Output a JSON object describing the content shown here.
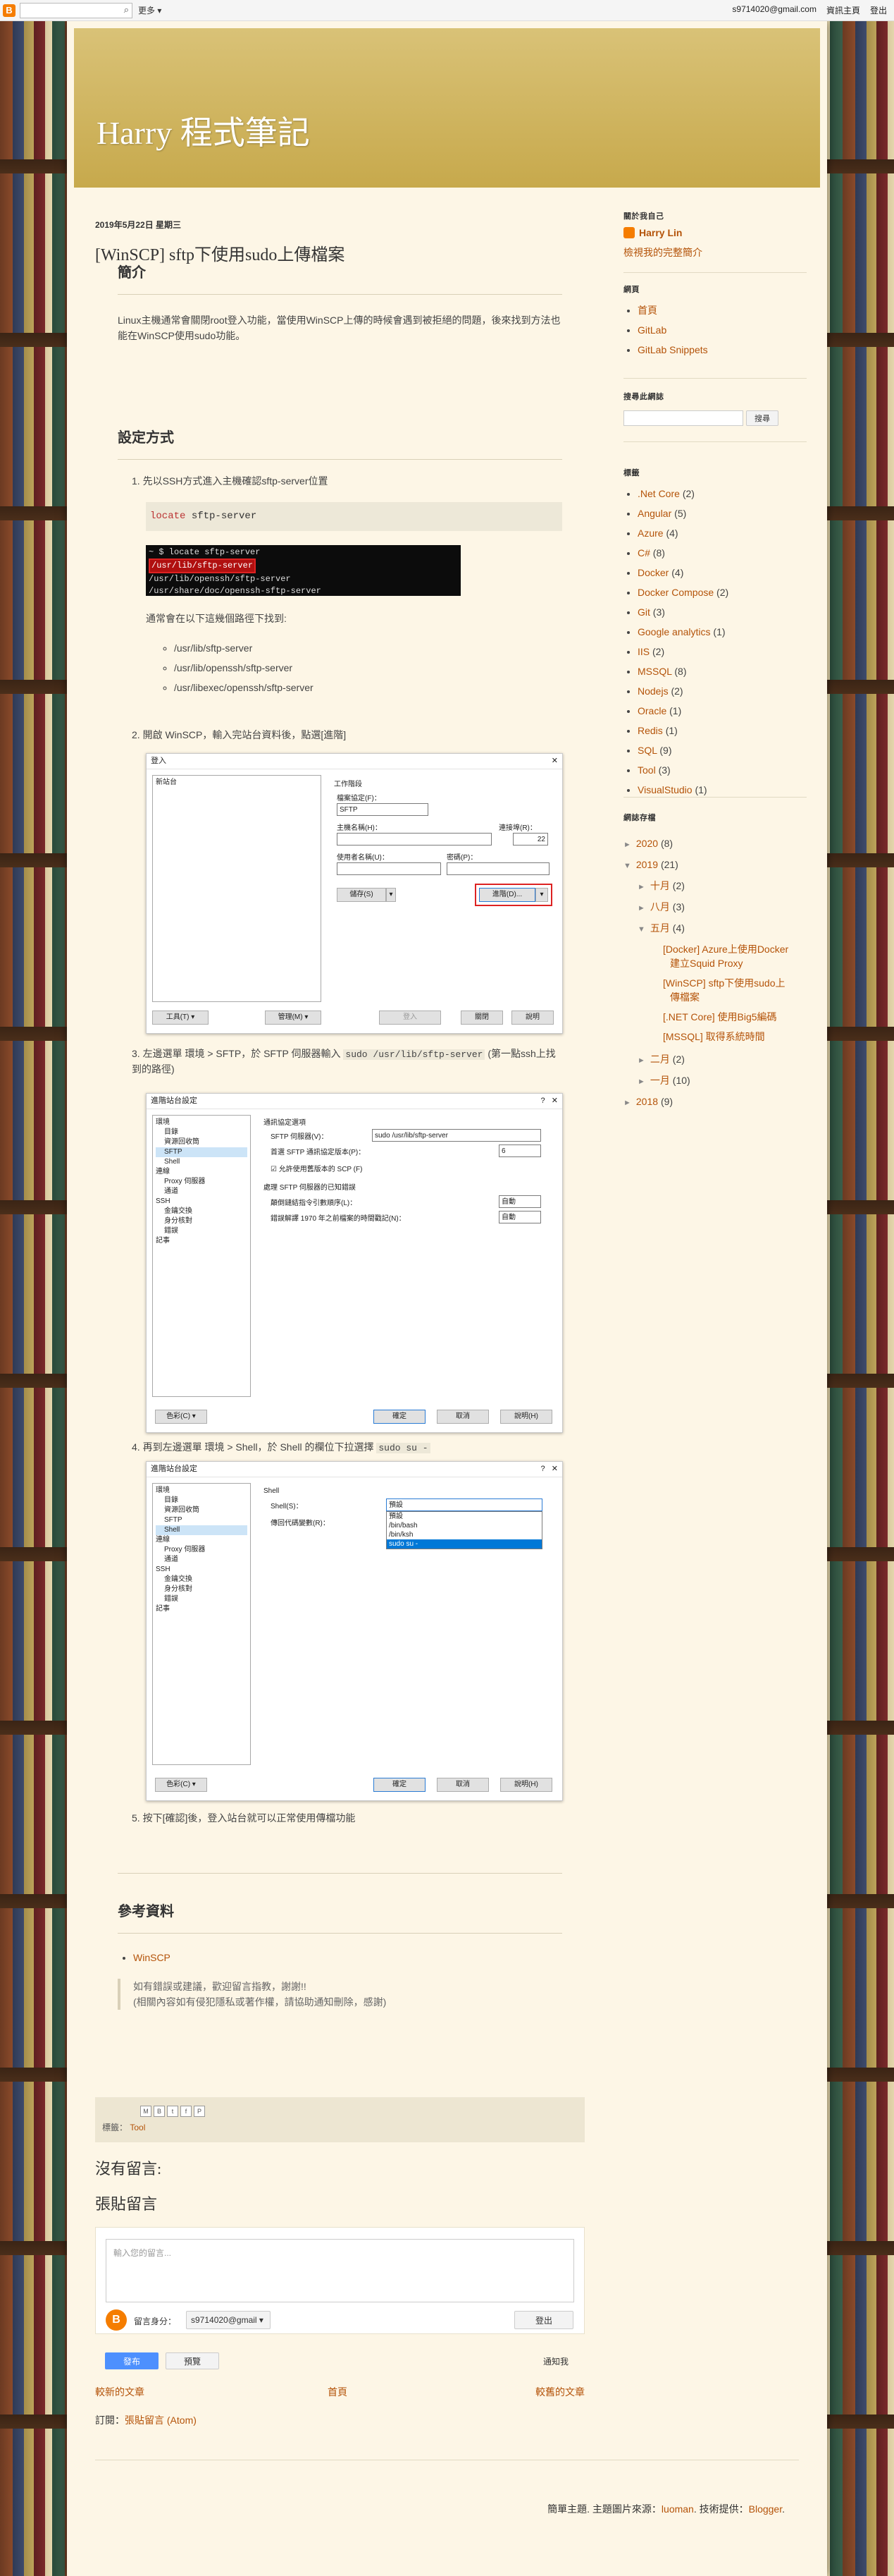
{
  "navbar": {
    "logo": "B",
    "more": "更多",
    "email": "s9714020@gmail.com",
    "dashboard": "資訊主頁",
    "logout": "登出"
  },
  "blog": {
    "title": "Harry 程式筆記"
  },
  "post": {
    "date": "2019年5月22日 星期三",
    "title": "[WinSCP] sftp下使用sudo上傳檔案",
    "intro_heading": "簡介",
    "intro_text": "Linux主機通常會關閉root登入功能，當使用WinSCP上傳的時候會遇到被拒絕的問題，後來找到方法也能在WinSCP使用sudo功能。",
    "setup_heading": "設定方式",
    "step1": "先以SSH方式進入主機確認sftp-server位置",
    "step1_code_kw": "locate",
    "step1_code_arg": " sftp-server",
    "terminal_lines": [
      "~ $ locate sftp-server",
      "/usr/lib/sftp-server",
      "/usr/lib/openssh/sftp-server",
      "/usr/share/doc/openssh-sftp-server"
    ],
    "paths_intro": "通常會在以下這幾個路徑下找到:",
    "paths": [
      "/usr/lib/sftp-server",
      "/usr/lib/openssh/sftp-server",
      "/usr/libexec/openssh/sftp-server"
    ],
    "step2": "開啟 WinSCP，輸入完站台資料後，點選[進階]",
    "step3_a": "左邊選單 環境 > SFTP，於 SFTP 伺服器輸入 ",
    "step3_code": "sudo /usr/lib/sftp-server",
    "step3_b": " (第一點ssh上找到的路徑)",
    "step4_a": "再到左邊選單 環境 > Shell，於 Shell 的欄位下拉選擇 ",
    "step4_code": "sudo su -",
    "step5": "按下[確認]後，登入站台就可以正常使用傳檔功能",
    "ref_heading": "參考資料",
    "ref_link": "WinSCP",
    "note_line1": "如有錯誤或建議，歡迎留言指教，謝謝!!",
    "note_line2": "(相關內容如有侵犯隱私或著作權，請協助通知刪除，感謝)"
  },
  "login_dialog": {
    "title": "登入",
    "new_site": "新站台",
    "session": "工作階段",
    "protocol_label": "檔案協定(F)：",
    "protocol": "SFTP",
    "host_label": "主機名稱(H)：",
    "port_label": "連接埠(R)：",
    "port": "22",
    "user_label": "使用者名稱(U)：",
    "pass_label": "密碼(P)：",
    "save": "儲存(S)",
    "advanced": "進階(D)...",
    "tools": "工具(T)",
    "manage": "管理(M)",
    "login": "登入",
    "close": "關閉",
    "help": "說明"
  },
  "adv_sftp": {
    "title": "進階站台設定",
    "tree": [
      "環境",
      "目錄",
      "資源回收筒",
      "SFTP",
      "Shell",
      "連線",
      "Proxy 伺服器",
      "通道",
      "SSH",
      "金鑰交換",
      "身分核對",
      "錯誤",
      "記事"
    ],
    "protocol_opts": "通訊協定選項",
    "server_label": "SFTP 伺服器(V)：",
    "server_value": "sudo /usr/lib/sftp-server",
    "version_label": "首選 SFTP 通訊協定版本(P)：",
    "version": "6",
    "allow_scp": "允許使用舊版本的 SCP (F)",
    "bugs": "處理 SFTP 伺服器的已知錯誤",
    "bug1": "顛倒鏈結指令引數順序(L)：",
    "bug2": "錯誤解譯 1970 年之前檔案的時間戳記(N)：",
    "auto": "自動",
    "color": "色彩(C)",
    "ok": "確定",
    "cancel": "取消",
    "help": "說明(H)"
  },
  "adv_shell": {
    "title": "進階站台設定",
    "group": "Shell",
    "shell_label": "Shell(S)：",
    "shell_value": "預設",
    "return_label": "傳回代碼變數(R)：",
    "options": [
      "預設",
      "/bin/bash",
      "/bin/ksh",
      "sudo su -"
    ]
  },
  "post_footer": {
    "share": [
      "M",
      "B",
      "t",
      "f",
      "P"
    ],
    "labels_title": "標籤：",
    "label": "Tool"
  },
  "comments": {
    "no_comments": "沒有留言:",
    "post_comment": "張貼留言",
    "placeholder": "輸入您的留言...",
    "reply_as": "留言身分：",
    "account": "s9714020@gmail",
    "logout": "登出",
    "publish": "發布",
    "preview": "預覽",
    "notify": "通知我"
  },
  "nav": {
    "newer": "較新的文章",
    "home": "首頁",
    "older": "較舊的文章",
    "subscribe": "訂閱：",
    "subscribe_link": "張貼留言 (Atom)"
  },
  "footer": {
    "text": "簡單主題. 主題圖片來源：",
    "author": "luoman",
    "powered": ". 技術提供：",
    "blogger": "Blogger",
    "end": "."
  },
  "sidebar": {
    "about_title": "關於我自己",
    "author": "Harry Lin",
    "profile_link": "檢視我的完整簡介",
    "pages_title": "網頁",
    "pages": [
      "首頁",
      "GitLab",
      "GitLab Snippets"
    ],
    "search_title": "搜尋此網誌",
    "search_btn": "搜尋",
    "labels_title": "標籤",
    "labels": [
      {
        "name": ".Net Core",
        "count": "(2)"
      },
      {
        "name": "Angular",
        "count": "(5)"
      },
      {
        "name": "Azure",
        "count": "(4)"
      },
      {
        "name": "C#",
        "count": "(8)"
      },
      {
        "name": "Docker",
        "count": "(4)"
      },
      {
        "name": "Docker Compose",
        "count": "(2)"
      },
      {
        "name": "Git",
        "count": "(3)"
      },
      {
        "name": "Google analytics",
        "count": "(1)"
      },
      {
        "name": "IIS",
        "count": "(2)"
      },
      {
        "name": "MSSQL",
        "count": "(8)"
      },
      {
        "name": "Nodejs",
        "count": "(2)"
      },
      {
        "name": "Oracle",
        "count": "(1)"
      },
      {
        "name": "Redis",
        "count": "(1)"
      },
      {
        "name": "SQL",
        "count": "(9)"
      },
      {
        "name": "Tool",
        "count": "(3)"
      },
      {
        "name": "VisualStudio",
        "count": "(1)"
      }
    ],
    "archive_title": "網誌存檔",
    "archive": {
      "y2020": "2020",
      "y2020c": "(8)",
      "y2019": "2019",
      "y2019c": "(21)",
      "oct": "十月",
      "octc": "(2)",
      "aug": "八月",
      "augc": "(3)",
      "may": "五月",
      "mayc": "(4)",
      "posts": [
        "[Docker] Azure上使用Docker建立Squid Proxy",
        "[WinSCP] sftp下使用sudo上傳檔案",
        "[.NET Core] 使用Big5編碼",
        "[MSSQL] 取得系統時間"
      ],
      "feb": "二月",
      "febc": "(2)",
      "jan": "一月",
      "janc": "(10)",
      "y2018": "2018",
      "y2018c": "(9)"
    }
  }
}
